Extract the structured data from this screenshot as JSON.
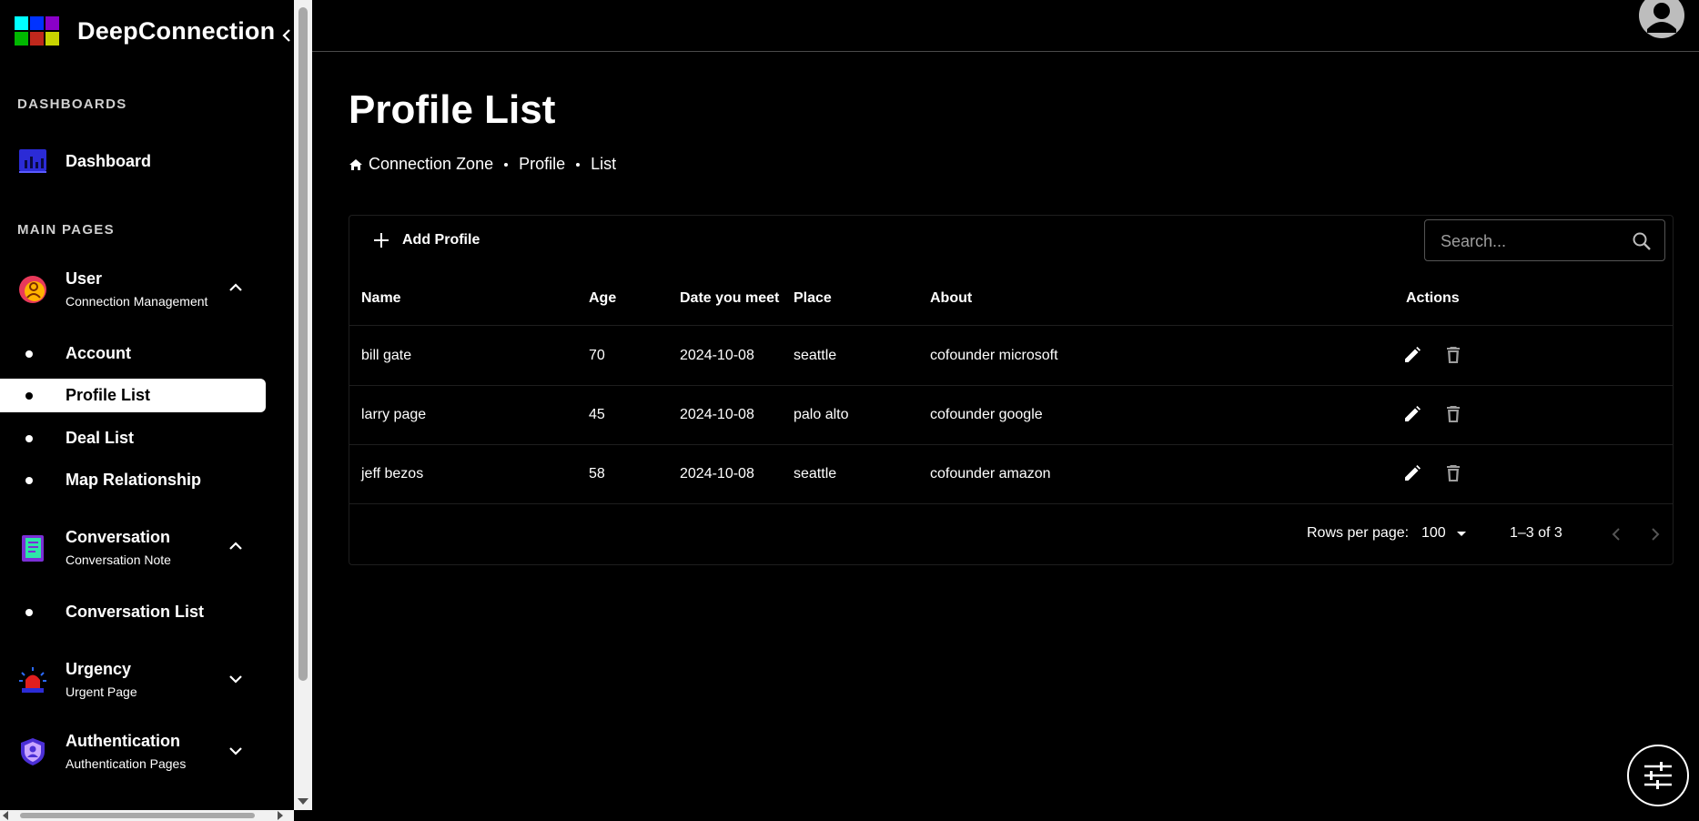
{
  "brand": {
    "name": "DeepConnection",
    "logo_colors": [
      "#00ffff",
      "#0033ff",
      "#8a00c8",
      "#00b800",
      "#c0281c",
      "#c8d400"
    ]
  },
  "sidebar": {
    "sections": {
      "dashboards": "DASHBOARDS",
      "main_pages": "MAIN PAGES"
    },
    "dashboard": {
      "label": "Dashboard",
      "icon": "chart-icon"
    },
    "user": {
      "title": "User",
      "subtitle": "Connection Management",
      "icon": "user-icon",
      "expanded": true,
      "items": [
        "Account",
        "Profile List",
        "Deal List",
        "Map Relationship"
      ],
      "active": "Profile List"
    },
    "conversation": {
      "title": "Conversation",
      "subtitle": "Conversation Note",
      "icon": "notebook-icon",
      "expanded": true,
      "items": [
        "Conversation List"
      ]
    },
    "urgency": {
      "title": "Urgency",
      "subtitle": "Urgent Page",
      "icon": "siren-icon",
      "expanded": false
    },
    "authentication": {
      "title": "Authentication",
      "subtitle": "Authentication Pages",
      "icon": "shield-icon",
      "expanded": false
    }
  },
  "page": {
    "title": "Profile List",
    "breadcrumb": [
      "Connection Zone",
      "Profile",
      "List"
    ]
  },
  "toolbar": {
    "add_label": "Add Profile",
    "search_placeholder": "Search..."
  },
  "table": {
    "columns": [
      "Name",
      "Age",
      "Date you meet",
      "Place",
      "About",
      "Actions"
    ],
    "rows": [
      {
        "name": "bill gate",
        "age": "70",
        "date": "2024-10-08",
        "place": "seattle",
        "about": "cofounder microsoft"
      },
      {
        "name": "larry page",
        "age": "45",
        "date": "2024-10-08",
        "place": "palo alto",
        "about": "cofounder google"
      },
      {
        "name": "jeff bezos",
        "age": "58",
        "date": "2024-10-08",
        "place": "seattle",
        "about": "cofounder amazon"
      }
    ]
  },
  "pagination": {
    "rows_per_page_label": "Rows per page:",
    "rows_per_page": "100",
    "range": "1–3 of 3"
  }
}
